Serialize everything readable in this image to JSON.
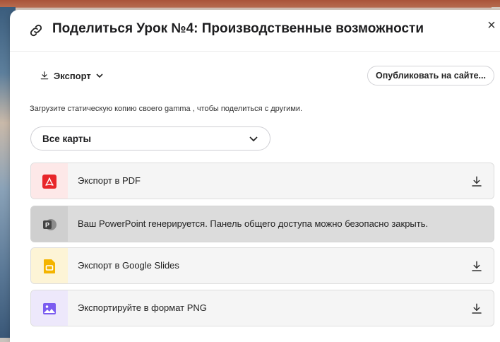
{
  "dialog": {
    "title": "Поделиться Урок №4: Производственные возможности",
    "close_symbol": "×"
  },
  "export_menu": {
    "label": "Экспорт",
    "icon": "download-icon"
  },
  "publish_button": {
    "label": "Опубликовать на сайте..."
  },
  "description": "Загрузите статическую копию своего gamma , чтобы поделиться с другими.",
  "cards_select": {
    "selected": "Все карты"
  },
  "export_options": [
    {
      "label": "Экспорт в PDF",
      "icon": "pdf-icon",
      "strip_color": "#fde8e8",
      "icon_color": "#e8262a"
    },
    {
      "label": "Ваш PowerPoint генерируется. Панель общего доступа можно безопасно закрыть.",
      "icon": "powerpoint-icon",
      "strip_color": "#cfcfcf",
      "icon_color": "#5a5a5a"
    },
    {
      "label": "Экспорт в Google Slides",
      "icon": "google-slides-icon",
      "strip_color": "#fdf4d6",
      "icon_color": "#f4b400"
    },
    {
      "label": "Экспортируйте в формат PNG",
      "icon": "image-icon",
      "strip_color": "#ede8fb",
      "icon_color": "#7b5cf0"
    }
  ]
}
